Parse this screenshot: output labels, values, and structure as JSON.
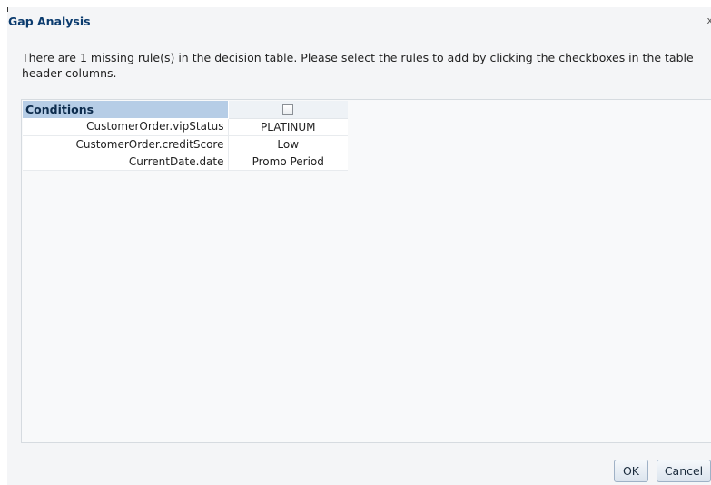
{
  "dialog": {
    "title": "Gap Analysis",
    "close_glyph": "x",
    "message": "There are 1 missing rule(s) in the decision table. Please select the rules to add by clicking the checkboxes in the table header columns."
  },
  "table": {
    "header": {
      "conditions_label": "Conditions",
      "rule_checked": false
    },
    "rows": [
      {
        "condition": "CustomerOrder.vipStatus",
        "value": "PLATINUM"
      },
      {
        "condition": "CustomerOrder.creditScore",
        "value": "Low"
      },
      {
        "condition": "CurrentDate.date",
        "value": "Promo Period"
      }
    ]
  },
  "buttons": {
    "ok_label": "OK",
    "cancel_label": "Cancel"
  }
}
